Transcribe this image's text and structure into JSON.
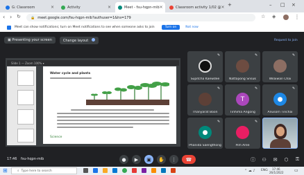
{
  "browser": {
    "tabs": [
      {
        "label": "G: Classroom",
        "color": "#1a73e8",
        "active": false
      },
      {
        "label": "Activity",
        "color": "#34a853",
        "active": false
      },
      {
        "label": "Meet - fsu-hqpn-mib",
        "color": "#00897b",
        "active": true
      },
      {
        "label": "Classroom activity 1/02 @",
        "color": "#ea4335",
        "active": false
      }
    ],
    "url": "meet.google.com/fsu-hqpn-mib?authuser=1&hs=179",
    "window_controls": [
      "–",
      "□",
      "×"
    ]
  },
  "banner": {
    "text": "Meet can show notifications; turn on Meet notifications to see when someone asks to join",
    "action_label": "Turn on",
    "dismiss_label": "Not now"
  },
  "meet": {
    "presentation_label": "Presenting your screen",
    "layout_chip": "Change layout",
    "people_link": "Request to join",
    "slide_toolbar_text": "Slide 1   —   Zoom   100%   ▾",
    "slide_title": "Water cycle and plants",
    "slide_footer": "Science"
  },
  "participants": [
    {
      "name": "Supitcha Kaewdee",
      "avatar_color": "#3c4043",
      "type": "photo-dark"
    },
    {
      "name": "Nattapong Srisuk",
      "avatar_color": "#6d4c41",
      "type": "photo"
    },
    {
      "name": "Wilaiwan Chai",
      "avatar_color": "#8d6e63",
      "type": "photo"
    },
    {
      "name": "Thanyarat Boon",
      "avatar_color": "#5d4037",
      "type": "photo"
    },
    {
      "name": "Tinhima Angong",
      "avatar_color": "#ab47bc",
      "type": "letter",
      "letter": "T"
    },
    {
      "name": "Anusorn Tinchai",
      "avatar_color": "#1e88e5",
      "type": "icon"
    },
    {
      "name": "Phanida Saengthong",
      "avatar_color": "#00897b",
      "type": "icon"
    },
    {
      "name": "Pim Aree",
      "avatar_color": "#e91e63",
      "type": "photo"
    },
    {
      "name": "",
      "avatar_color": "#f6c343",
      "type": "video"
    }
  ],
  "controls": {
    "meeting_time": "17:46",
    "meeting_code": "fsu-hqpn-mib",
    "buttons": [
      "mic",
      "camera",
      "present",
      "raise-hand",
      "more",
      "leave"
    ]
  },
  "taskbar": {
    "search_placeholder": "Type here to search",
    "time": "17:46",
    "date": "26/1/2022",
    "lang": "ENG"
  }
}
